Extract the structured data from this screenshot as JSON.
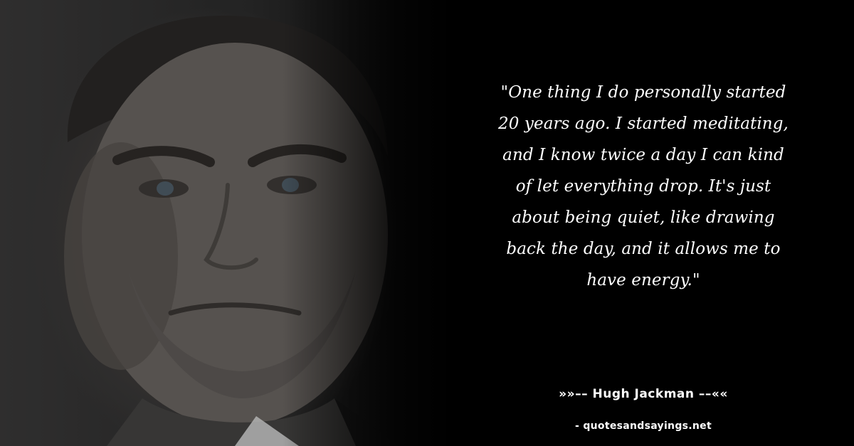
{
  "quote": {
    "lines": [
      "\"One thing I do personally started",
      "20 years ago. I started meditating,",
      "and I know twice a day I can kind",
      "of let everything drop. It's just",
      "about being quiet, like drawing",
      "back the day, and it allows me to",
      "have energy.\""
    ]
  },
  "author": {
    "text": "»»–– Hugh Jackman ––««"
  },
  "site": {
    "text": "- quotesandsayings.net"
  },
  "photo": {
    "subject": "portrait-photo"
  },
  "colors": {
    "background": "#000000",
    "text": "#ffffff"
  }
}
